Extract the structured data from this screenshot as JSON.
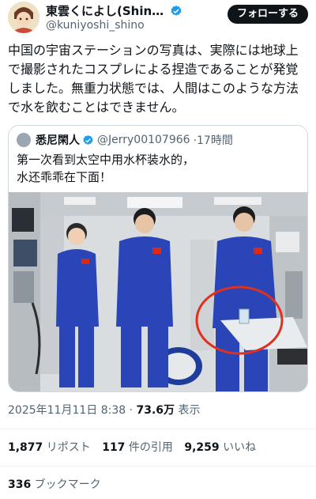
{
  "author": {
    "display_name": "東雲くによし(Shin…",
    "handle": "@kuniyoshi_shino",
    "follow_label": "フォローする"
  },
  "tweet": {
    "text": "中国の宇宙ステーションの写真は、実際には地球上で撮影されたコスプレによる捏造であることが発覚しました。無重力状態では、人間はこのような方法で水を飲むことはできません。"
  },
  "quote": {
    "name": "悉尼閑人",
    "handle": "@Jerry00107966",
    "time": "·17時間",
    "text_line1": "第一次看到太空中用水杯装水的，",
    "text_line2": "水还乖乖在下面！"
  },
  "meta": {
    "datetime": "2025年11月11日 8:38 · ",
    "views": "73.6万",
    "views_label": " 表示"
  },
  "stats": {
    "reposts": "1,877",
    "reposts_label": " リポスト",
    "quotes": "117",
    "quotes_label": " 件の引用",
    "likes": "9,259",
    "likes_label": " いいね",
    "bookmarks": "336",
    "bookmarks_label": " ブックマーク"
  },
  "colors": {
    "verified": "#1d9bf0",
    "annotation_circle": "#e0301e",
    "suit": "#2a45b8"
  },
  "icons": [
    "verified-badge-icon"
  ]
}
